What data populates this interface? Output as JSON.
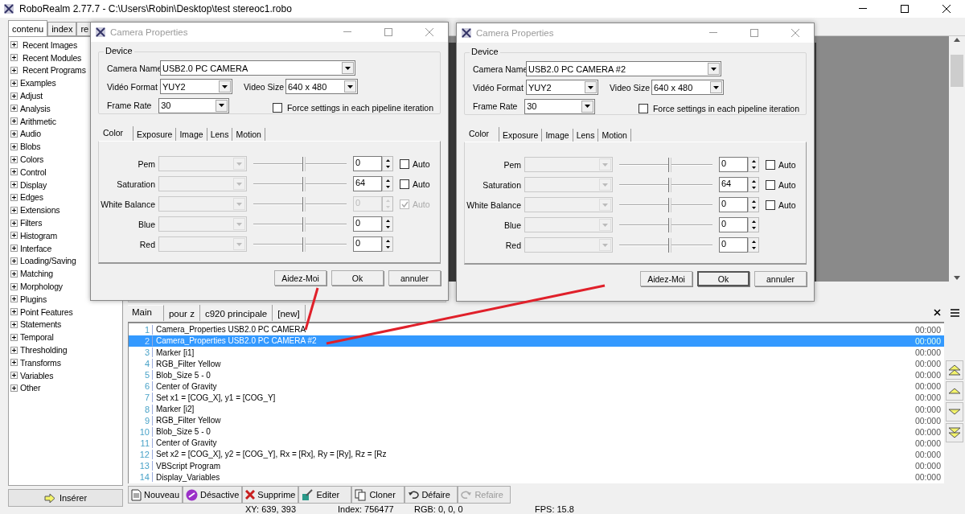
{
  "window": {
    "title": "RoboRealm 2.77.7 - C:\\Users\\Robin\\Desktop\\test stereoc1.robo"
  },
  "sidebar": {
    "tabs": [
      {
        "label": "contenu",
        "selected": true
      },
      {
        "label": "index",
        "selected": false
      },
      {
        "label": "re",
        "selected": false
      }
    ],
    "items": [
      {
        "label": "Recent Images",
        "expanded": false,
        "kind": "recent"
      },
      {
        "label": "Recent Modules",
        "expanded": false,
        "kind": "recent"
      },
      {
        "label": "Recent Programs",
        "expanded": false,
        "kind": "recent"
      },
      {
        "label": "Examples",
        "expanded": false,
        "kind": "folder"
      },
      {
        "label": "Adjust",
        "expanded": false,
        "kind": "folder"
      },
      {
        "label": "Analysis",
        "expanded": false,
        "kind": "folder"
      },
      {
        "label": "Arithmetic",
        "expanded": false,
        "kind": "folder"
      },
      {
        "label": "Audio",
        "expanded": false,
        "kind": "folder"
      },
      {
        "label": "Blobs",
        "expanded": false,
        "kind": "folder"
      },
      {
        "label": "Colors",
        "expanded": false,
        "kind": "folder"
      },
      {
        "label": "Control",
        "expanded": false,
        "kind": "folder"
      },
      {
        "label": "Display",
        "expanded": false,
        "kind": "folder"
      },
      {
        "label": "Edges",
        "expanded": false,
        "kind": "folder"
      },
      {
        "label": "Extensions",
        "expanded": false,
        "kind": "folder"
      },
      {
        "label": "Filters",
        "expanded": false,
        "kind": "folder"
      },
      {
        "label": "Histogram",
        "expanded": false,
        "kind": "folder"
      },
      {
        "label": "Interface",
        "expanded": false,
        "kind": "folder"
      },
      {
        "label": "Loading/Saving",
        "expanded": false,
        "kind": "folder"
      },
      {
        "label": "Matching",
        "expanded": false,
        "kind": "folder"
      },
      {
        "label": "Morphology",
        "expanded": false,
        "kind": "folder"
      },
      {
        "label": "Plugins",
        "expanded": false,
        "kind": "folder"
      },
      {
        "label": "Point Features",
        "expanded": false,
        "kind": "folder"
      },
      {
        "label": "Statements",
        "expanded": false,
        "kind": "folder"
      },
      {
        "label": "Temporal",
        "expanded": false,
        "kind": "folder"
      },
      {
        "label": "Thresholding",
        "expanded": false,
        "kind": "folder"
      },
      {
        "label": "Transforms",
        "expanded": false,
        "kind": "folder"
      },
      {
        "label": "Variables",
        "expanded": false,
        "kind": "folder"
      },
      {
        "label": "Other",
        "expanded": false,
        "kind": "folder"
      }
    ],
    "insert_button": "Insérer"
  },
  "pipeline": {
    "tabs": [
      {
        "label": "Main",
        "selected": true
      },
      {
        "label": "pour z",
        "selected": false
      },
      {
        "label": "c920 principale",
        "selected": false
      },
      {
        "label": "[new]",
        "selected": false
      }
    ],
    "rows": [
      {
        "number": "1",
        "text": "Camera_Properties USB2.0 PC CAMERA",
        "time": "00:000",
        "selected": false
      },
      {
        "number": "2",
        "text": "Camera_Properties USB2.0 PC CAMERA #2",
        "time": "00:000",
        "selected": true
      },
      {
        "number": "3",
        "text": "Marker [i1]",
        "time": "00:000",
        "selected": false
      },
      {
        "number": "4",
        "text": "RGB_Filter Yellow",
        "time": "00:000",
        "selected": false
      },
      {
        "number": "5",
        "text": "Blob_Size 5 - 0",
        "time": "00:000",
        "selected": false
      },
      {
        "number": "6",
        "text": "Center of Gravity",
        "time": "00:000",
        "selected": false
      },
      {
        "number": "7",
        "text": "Set x1 = [COG_X], y1 = [COG_Y]",
        "time": "00:000",
        "selected": false
      },
      {
        "number": "8",
        "text": "Marker [i2]",
        "time": "00:000",
        "selected": false
      },
      {
        "number": "9",
        "text": "RGB_Filter Yellow",
        "time": "00:000",
        "selected": false
      },
      {
        "number": "10",
        "text": "Blob_Size 5 - 0",
        "time": "00:000",
        "selected": false
      },
      {
        "number": "11",
        "text": "Center of Gravity",
        "time": "00:000",
        "selected": false
      },
      {
        "number": "12",
        "text": "Set x2 = [COG_X], y2 = [COG_Y], Rx = [Rx], Ry = [Ry], Rz = [Rz",
        "time": "00:000",
        "selected": false
      },
      {
        "number": "13",
        "text": "VBScript Program",
        "time": "00:000",
        "selected": false
      },
      {
        "number": "14",
        "text": "Display_Variables",
        "time": "00:000",
        "selected": false
      }
    ],
    "buttons": [
      {
        "label": "Nouveau",
        "kind": "new",
        "disabled": false
      },
      {
        "label": "Désactive",
        "kind": "disable",
        "disabled": false
      },
      {
        "label": "Supprime",
        "kind": "delete",
        "disabled": false
      },
      {
        "label": "Editer",
        "kind": "edit",
        "disabled": false
      },
      {
        "label": "Cloner",
        "kind": "clone",
        "disabled": false
      },
      {
        "label": "Défaire",
        "kind": "undo",
        "disabled": false
      },
      {
        "label": "Refaire",
        "kind": "redo",
        "disabled": true
      }
    ]
  },
  "status_bar": [
    "XY: 639, 393",
    "Index: 756477",
    "RGB: 0, 0, 0",
    "FPS: 15.8"
  ],
  "dialogs": [
    {
      "title": "Camera Properties",
      "device": {
        "label": "Device",
        "camera_name": {
          "label": "Camera Name",
          "value": "USB2.0 PC CAMERA"
        },
        "video_format": {
          "label": "Vidéo Format",
          "value": "YUY2"
        },
        "video_size": {
          "label": "Video Size",
          "value": "640 x 480"
        },
        "frame_rate": {
          "label": "Frame Rate",
          "value": "30"
        },
        "force": {
          "label": "Force settings in each pipeline iteration",
          "checked": false
        }
      },
      "tabs": [
        {
          "label": "Color",
          "selected": true
        },
        {
          "label": "Exposure",
          "selected": false
        },
        {
          "label": "Image",
          "selected": false
        },
        {
          "label": "Lens",
          "selected": false
        },
        {
          "label": "Motion",
          "selected": false
        }
      ],
      "sliders": [
        {
          "label": "Pem",
          "level": 0.54,
          "value": "0",
          "disabled": false,
          "auto": {
            "label": "Auto",
            "checked": false
          }
        },
        {
          "label": "Saturation",
          "level": 0.54,
          "value": "64",
          "disabled": false,
          "auto": {
            "label": "Auto",
            "checked": false
          }
        },
        {
          "label": "White Balance",
          "level": 0.54,
          "value": "0",
          "disabled": true,
          "auto": {
            "label": "Auto",
            "checked": true
          }
        },
        {
          "label": "Blue",
          "level": 0.54,
          "value": "0",
          "disabled": false
        },
        {
          "label": "Red",
          "level": 0.54,
          "value": "0",
          "disabled": false
        }
      ],
      "buttons": [
        {
          "label": "Aidez-Moi",
          "default": false
        },
        {
          "label": "Ok",
          "default": false
        },
        {
          "label": "annuler",
          "default": false
        }
      ]
    },
    {
      "title": "Camera Properties",
      "device": {
        "label": "Device",
        "camera_name": {
          "label": "Camera Name",
          "value": "USB2.0 PC CAMERA #2"
        },
        "video_format": {
          "label": "Vidéo Format",
          "value": "YUY2"
        },
        "video_size": {
          "label": "Video Size",
          "value": "640 x 480"
        },
        "frame_rate": {
          "label": "Frame Rate",
          "value": "30"
        },
        "force": {
          "label": "Force settings in each pipeline iteration",
          "checked": false
        }
      },
      "tabs": [
        {
          "label": "Color",
          "selected": true
        },
        {
          "label": "Exposure",
          "selected": false
        },
        {
          "label": "Image",
          "selected": false
        },
        {
          "label": "Lens",
          "selected": false
        },
        {
          "label": "Motion",
          "selected": false
        }
      ],
      "sliders": [
        {
          "label": "Pem",
          "level": 0.54,
          "value": "0",
          "disabled": false,
          "auto": {
            "label": "Auto",
            "checked": false
          }
        },
        {
          "label": "Saturation",
          "level": 0.54,
          "value": "64",
          "disabled": false,
          "auto": {
            "label": "Auto",
            "checked": false
          }
        },
        {
          "label": "White Balance",
          "level": 0.54,
          "value": "0",
          "disabled": false,
          "auto": {
            "label": "Auto",
            "checked": false
          }
        },
        {
          "label": "Blue",
          "level": 0.54,
          "value": "0",
          "disabled": false
        },
        {
          "label": "Red",
          "level": 0.54,
          "value": "0",
          "disabled": false
        }
      ],
      "buttons": [
        {
          "label": "Aidez-Moi",
          "default": false
        },
        {
          "label": "Ok",
          "default": true
        },
        {
          "label": "annuler",
          "default": false
        }
      ]
    }
  ]
}
